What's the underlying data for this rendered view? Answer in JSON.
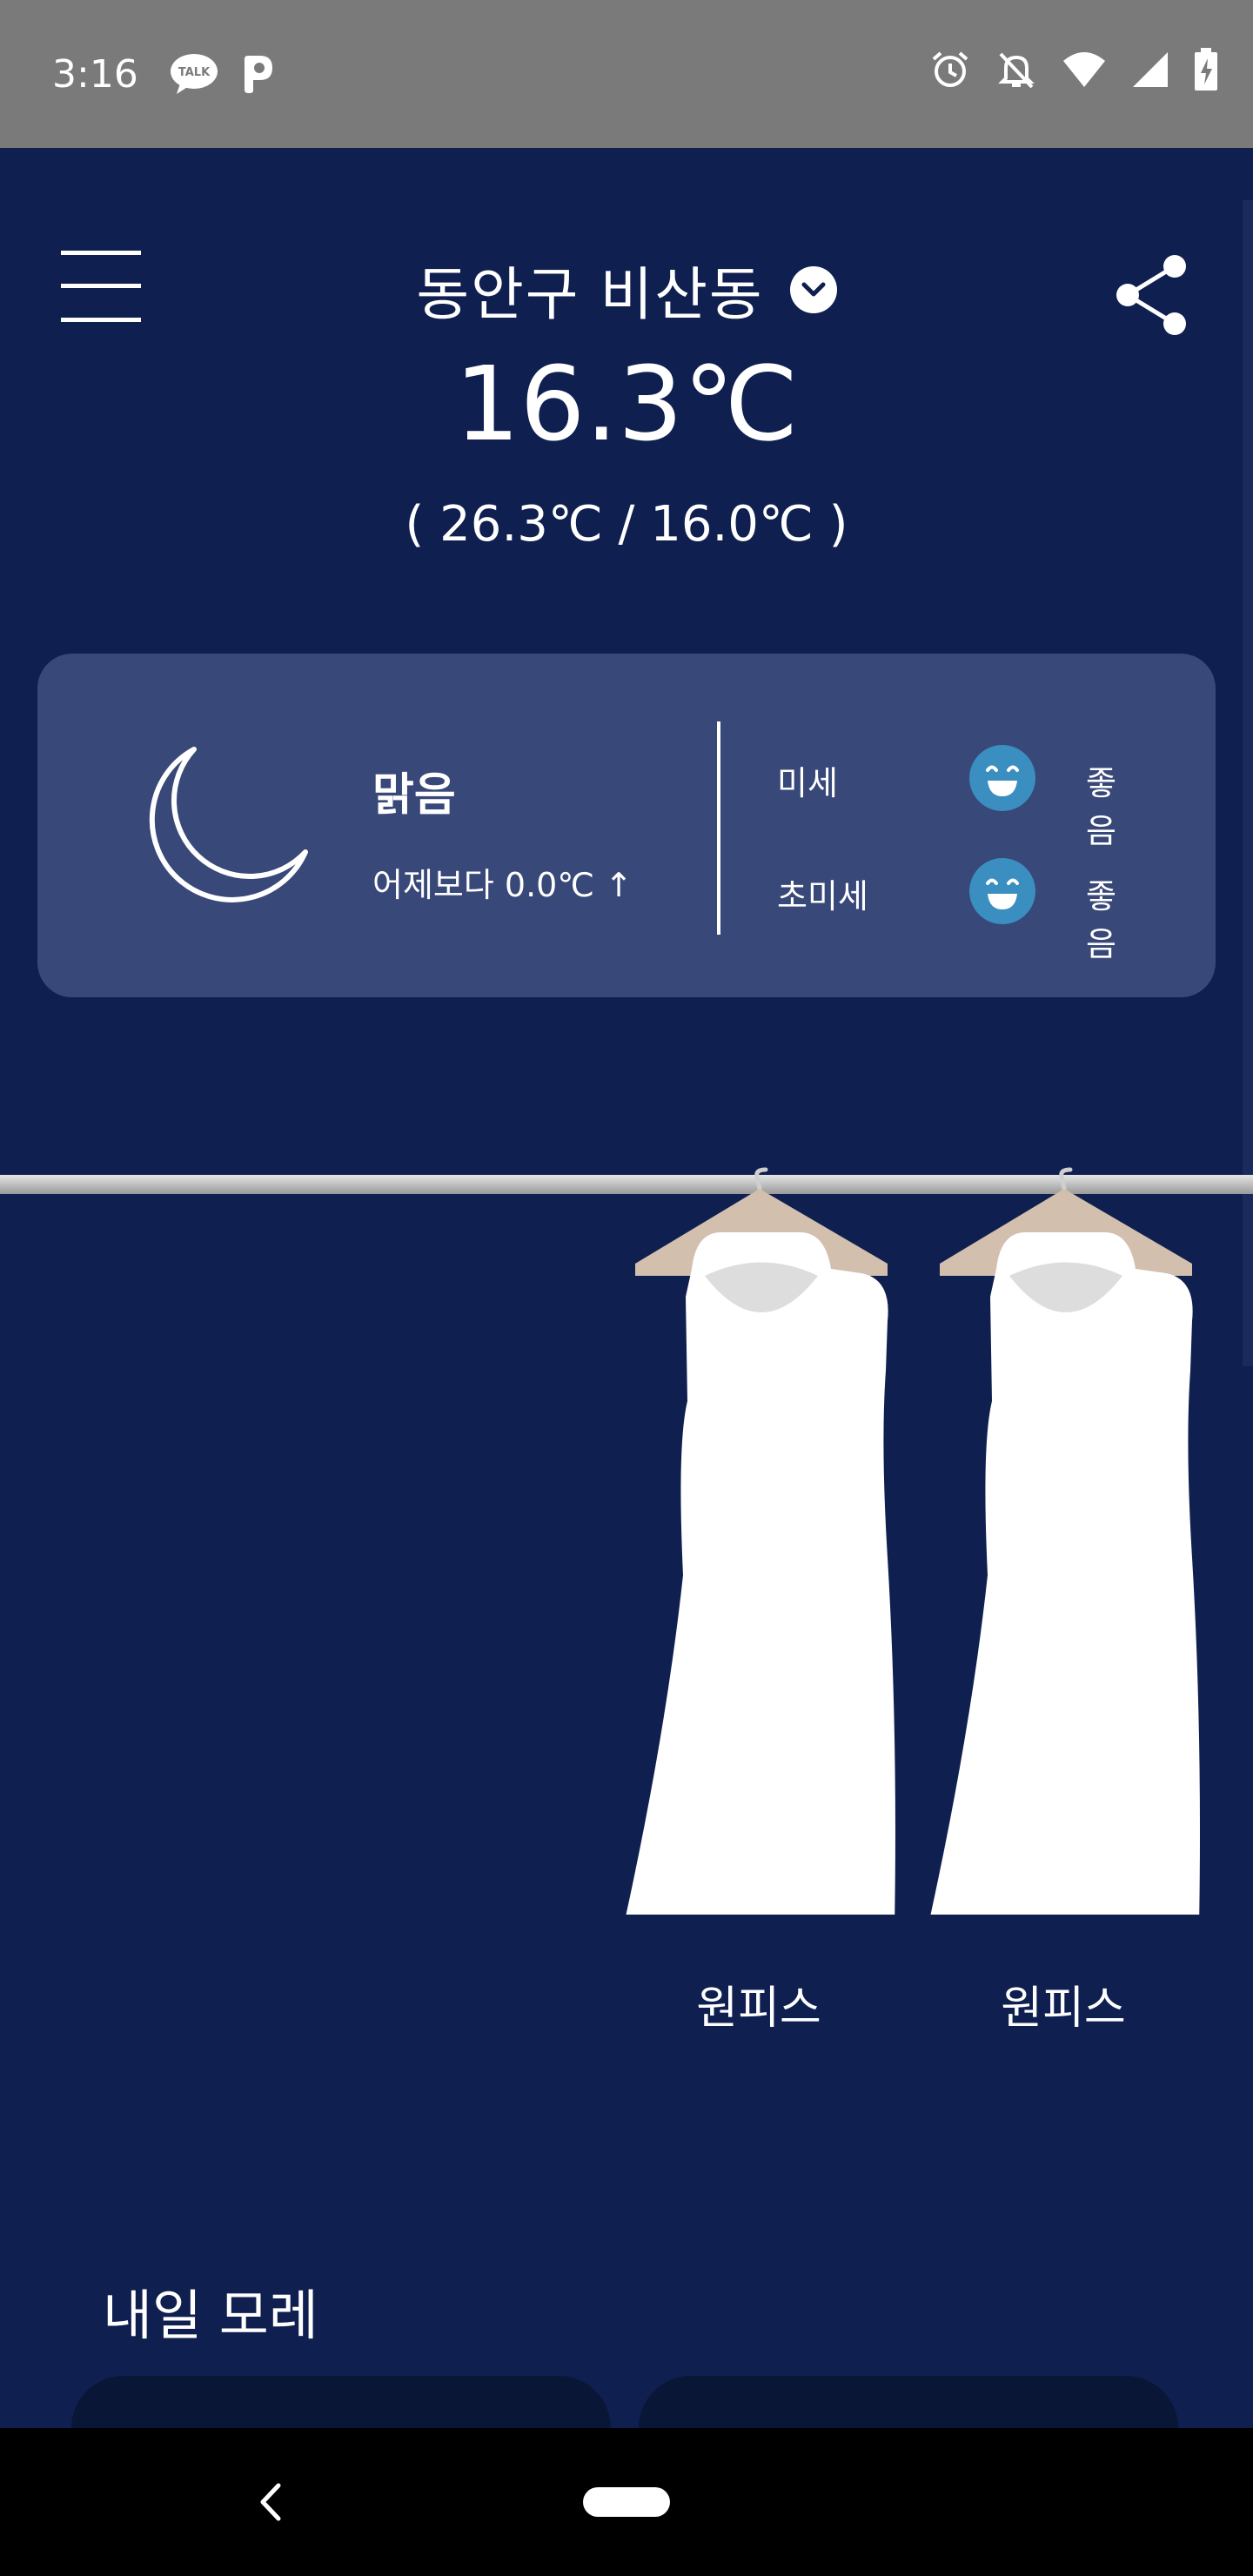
{
  "status_bar": {
    "time": "3:16",
    "left_icons": [
      "kakaotalk-icon",
      "parking-icon"
    ],
    "right_icons": [
      "alarm-icon",
      "mute-icon",
      "wifi-icon",
      "signal-icon",
      "battery-charging-icon"
    ]
  },
  "header": {
    "location": "동안구 비산동",
    "current_temp": "16.3℃",
    "minmax": "( 26.3℃ / 16.0℃ )"
  },
  "weather_card": {
    "condition": "맑음",
    "compare": "어제보다 0.0℃ ↑",
    "condition_icon": "moon-icon",
    "dust": [
      {
        "label": "미세",
        "status": "좋음",
        "icon": "smile-face-icon"
      },
      {
        "label": "초미세",
        "status": "좋음",
        "icon": "smile-face-icon"
      }
    ]
  },
  "garments": [
    {
      "label": "원피스",
      "icon": "dress-icon"
    },
    {
      "label": "원피스",
      "icon": "dress-icon"
    }
  ],
  "forecast": {
    "title": "내일 모레"
  },
  "colors": {
    "background": "#0f1f4f",
    "card": "#384878",
    "face": "#3a8ec0",
    "hanger": "#d2bfae"
  }
}
